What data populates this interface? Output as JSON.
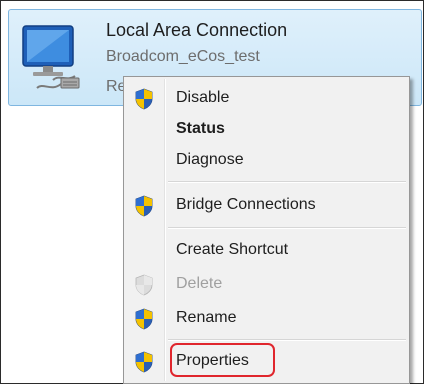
{
  "connection": {
    "title": "Local Area Connection",
    "network": "Broadcom_eCos_test",
    "status_partial": "Re",
    "icon": "network-adapter-icon"
  },
  "context_menu": {
    "items": [
      {
        "label": "Disable",
        "icon": "uac-shield-icon"
      },
      {
        "label": "Status",
        "default": true
      },
      {
        "label": "Diagnose"
      },
      {
        "label": "Bridge Connections",
        "icon": "uac-shield-icon"
      },
      {
        "label": "Create Shortcut"
      },
      {
        "label": "Delete",
        "icon": "uac-shield-icon",
        "disabled": true
      },
      {
        "label": "Rename",
        "icon": "uac-shield-icon"
      },
      {
        "label": "Properties",
        "icon": "uac-shield-icon",
        "highlighted": true
      }
    ]
  },
  "colors": {
    "selection_bg": "#cce7f8",
    "menu_bg": "#f1f1f1",
    "highlight_ring": "#e0262d"
  }
}
